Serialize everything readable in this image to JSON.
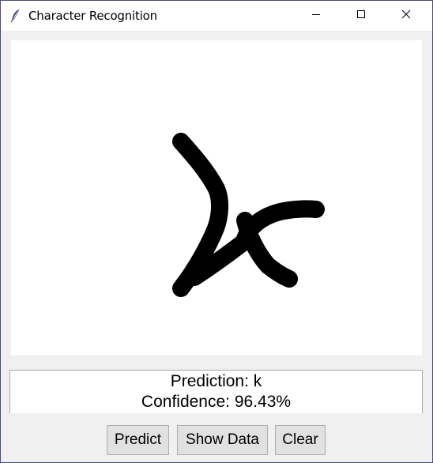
{
  "window": {
    "title": "Character Recognition"
  },
  "result": {
    "prediction_text": "Prediction: k",
    "confidence_text": "Confidence: 96.43%"
  },
  "buttons": {
    "predict_label": "Predict",
    "show_data_label": "Show Data",
    "clear_label": "Clear"
  },
  "icons": {
    "app": "feather-icon",
    "minimize": "minimize-icon",
    "maximize": "maximize-icon",
    "close": "close-icon"
  },
  "colors": {
    "stroke": "#000000",
    "canvas_background": "#ffffff",
    "window_background": "#f0f0f0",
    "button_background": "#e1e1e1"
  }
}
